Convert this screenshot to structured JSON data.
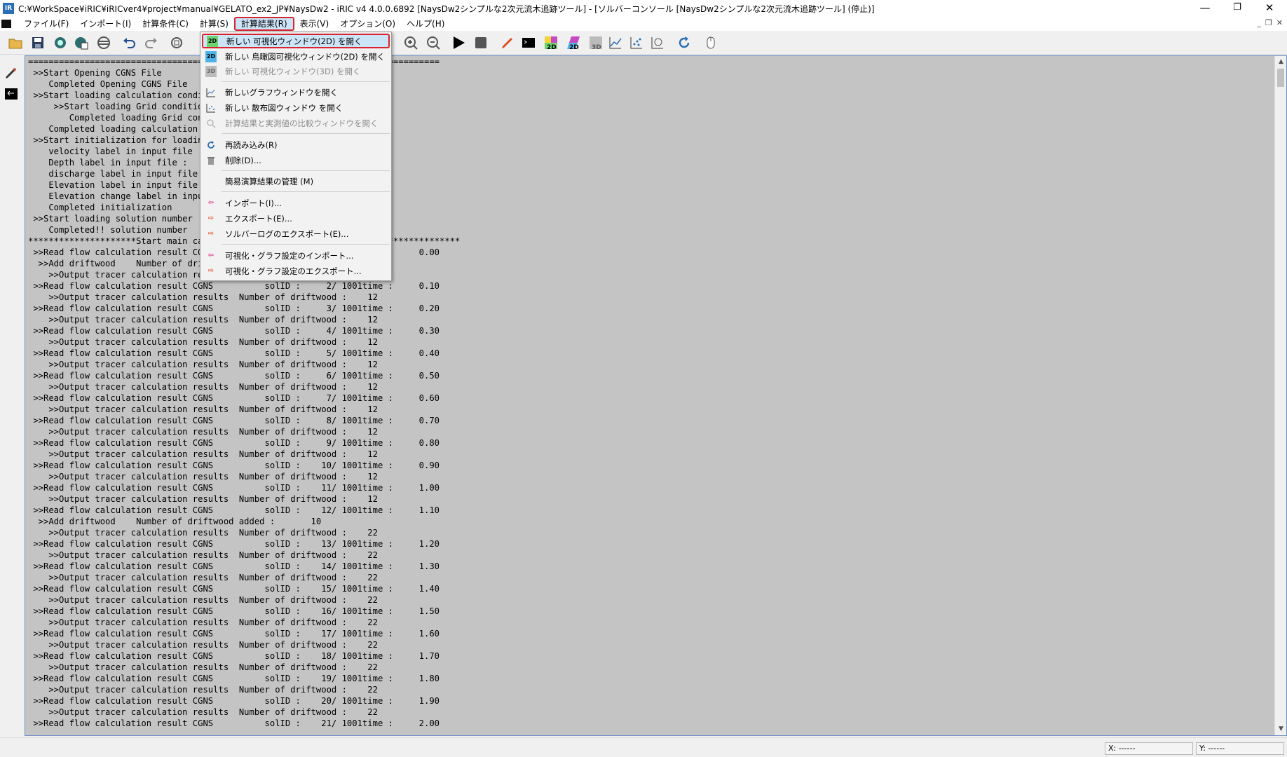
{
  "window": {
    "title": "C:¥WorkSpace¥iRIC¥iRICver4¥project¥manual¥GELATO_ex2_JP¥NaysDw2 - iRIC v4 4.0.0.6892 [NaysDw2シンプルな2次元流木追跡ツール] - [ソルバーコンソール [NaysDw2シンプルな2次元流木追跡ツール] (停止)]",
    "minimize": "—",
    "restore": "❐",
    "close": "✕"
  },
  "menu": {
    "file": "ファイル(F)",
    "import": "インポート(I)",
    "calc_cond": "計算条件(C)",
    "calc": "計算(S)",
    "calc_result": "計算結果(R)",
    "view": "表示(V)",
    "option": "オプション(O)",
    "help": "ヘルプ(H)"
  },
  "mdi": {
    "min": "_",
    "restore": "❐",
    "close": "✕"
  },
  "dropdown": {
    "items": [
      {
        "label": "新しい 可視化ウィンドウ(2D) を開く",
        "icon": "2D"
      },
      {
        "label": "新しい 鳥瞰図可視化ウィンドウ(2D) を開く",
        "icon": "2D"
      },
      {
        "label": "新しい 可視化ウィンドウ(3D) を開く",
        "icon": "3D"
      },
      {
        "label": "新しいグラフウィンドウを開く"
      },
      {
        "label": "新しい 散布図ウィンドウ を開く"
      },
      {
        "label": "計算結果と実測値の比較ウィンドウを開く"
      },
      {
        "label": "再読み込み(R)"
      },
      {
        "label": "削除(D)..."
      },
      {
        "label": "簡易演算結果の管理 (M)"
      },
      {
        "label": "インポート(I)..."
      },
      {
        "label": "エクスポート(E)..."
      },
      {
        "label": "ソルバーログのエクスポート(E)..."
      },
      {
        "label": "可視化・グラフ設定のインポート..."
      },
      {
        "label": "可視化・グラフ設定のエクスポート..."
      }
    ]
  },
  "toolbar": {
    "badge_2d": "2D",
    "badge_3d": "3D"
  },
  "console": {
    "lines": [
      "================================================================================",
      " >>Start Opening CGNS File",
      "    Completed Opening CGNS File",
      " >>Start loading calculation condition",
      "     >>Start loading Grid condition",
      "        Completed loading Grid condition",
      "    Completed loading calculation condition",
      " >>Start initialization for loading solution",
      "    velocity label in input file :",
      "    Depth label in input file :",
      "    discharge label in input file :",
      "    Elevation label in input file :",
      "    Elevation change label in input file :",
      "    Completed initialization",
      " >>Start loading solution number",
      "    Completed!! solution number",
      "*********************Start main calculation*****************************************",
      " >>Read flow calculation result CGNS          solID :     1/ 1001time :     0.00",
      "  >>Add driftwood    Number of driftwood added :       12",
      "    >>Output tracer calculation results  Number of driftwood :    12",
      " >>Read flow calculation result CGNS          solID :     2/ 1001time :     0.10",
      "    >>Output tracer calculation results  Number of driftwood :    12",
      " >>Read flow calculation result CGNS          solID :     3/ 1001time :     0.20",
      "    >>Output tracer calculation results  Number of driftwood :    12",
      " >>Read flow calculation result CGNS          solID :     4/ 1001time :     0.30",
      "    >>Output tracer calculation results  Number of driftwood :    12",
      " >>Read flow calculation result CGNS          solID :     5/ 1001time :     0.40",
      "    >>Output tracer calculation results  Number of driftwood :    12",
      " >>Read flow calculation result CGNS          solID :     6/ 1001time :     0.50",
      "    >>Output tracer calculation results  Number of driftwood :    12",
      " >>Read flow calculation result CGNS          solID :     7/ 1001time :     0.60",
      "    >>Output tracer calculation results  Number of driftwood :    12",
      " >>Read flow calculation result CGNS          solID :     8/ 1001time :     0.70",
      "    >>Output tracer calculation results  Number of driftwood :    12",
      " >>Read flow calculation result CGNS          solID :     9/ 1001time :     0.80",
      "    >>Output tracer calculation results  Number of driftwood :    12",
      " >>Read flow calculation result CGNS          solID :    10/ 1001time :     0.90",
      "    >>Output tracer calculation results  Number of driftwood :    12",
      " >>Read flow calculation result CGNS          solID :    11/ 1001time :     1.00",
      "    >>Output tracer calculation results  Number of driftwood :    12",
      " >>Read flow calculation result CGNS          solID :    12/ 1001time :     1.10",
      "  >>Add driftwood    Number of driftwood added :       10",
      "    >>Output tracer calculation results  Number of driftwood :    22",
      " >>Read flow calculation result CGNS          solID :    13/ 1001time :     1.20",
      "    >>Output tracer calculation results  Number of driftwood :    22",
      " >>Read flow calculation result CGNS          solID :    14/ 1001time :     1.30",
      "    >>Output tracer calculation results  Number of driftwood :    22",
      " >>Read flow calculation result CGNS          solID :    15/ 1001time :     1.40",
      "    >>Output tracer calculation results  Number of driftwood :    22",
      " >>Read flow calculation result CGNS          solID :    16/ 1001time :     1.50",
      "    >>Output tracer calculation results  Number of driftwood :    22",
      " >>Read flow calculation result CGNS          solID :    17/ 1001time :     1.60",
      "    >>Output tracer calculation results  Number of driftwood :    22",
      " >>Read flow calculation result CGNS          solID :    18/ 1001time :     1.70",
      "    >>Output tracer calculation results  Number of driftwood :    22",
      " >>Read flow calculation result CGNS          solID :    19/ 1001time :     1.80",
      "    >>Output tracer calculation results  Number of driftwood :    22",
      " >>Read flow calculation result CGNS          solID :    20/ 1001time :     1.90",
      "    >>Output tracer calculation results  Number of driftwood :    22",
      " >>Read flow calculation result CGNS          solID :    21/ 1001time :     2.00"
    ]
  },
  "status": {
    "x": "X: ------",
    "y": "Y: ------"
  },
  "colors": {
    "highlight_border": "#d9232e",
    "highlight_fill": "#cce4f7",
    "console_bg": "#c4c4c4"
  }
}
